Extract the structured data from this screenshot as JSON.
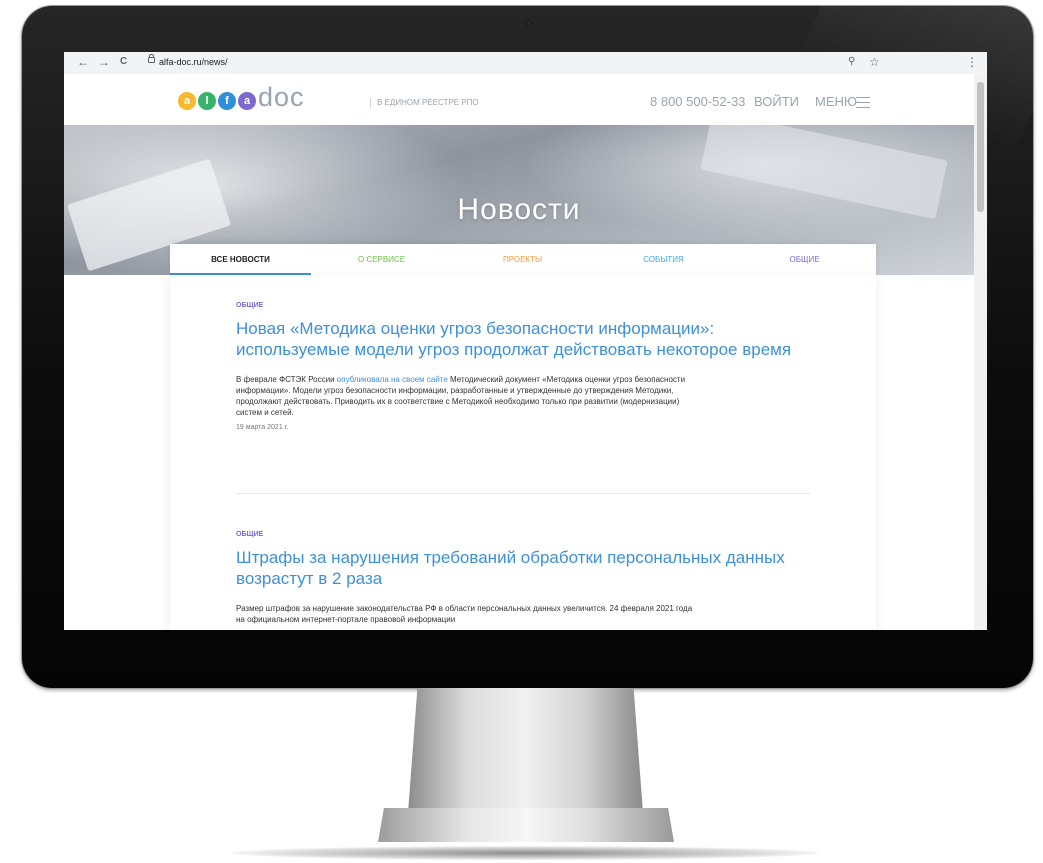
{
  "browser": {
    "back_icon": "arrow-left-icon",
    "forward_icon": "arrow-right-icon",
    "reload_icon": "reload-icon",
    "url": "alfa-doc.ru/news/",
    "back_glyph": "←",
    "forward_glyph": "→",
    "reload_glyph": "C",
    "zoom_glyph": "⚲",
    "star_glyph": "☆",
    "menu_glyph": "⋮"
  },
  "header": {
    "logo": {
      "letters": [
        "a",
        "l",
        "f",
        "a"
      ],
      "colors": [
        "#f5b82e",
        "#39b36b",
        "#2f8fd8",
        "#7c6ad1"
      ],
      "suffix": "doc"
    },
    "registry": "В ЕДИНОМ РЕЕСТРЕ РПО",
    "phone": "8 800 500-52-33",
    "login": "ВОЙТИ",
    "menu": "МЕНЮ"
  },
  "banner": {
    "title": "Новости"
  },
  "tabs": [
    {
      "label": "ВСЕ НОВОСТИ",
      "color": "#222222",
      "active": true
    },
    {
      "label": "О СЕРВИСЕ",
      "color": "#6cc04a",
      "active": false
    },
    {
      "label": "ПРОЕКТЫ",
      "color": "#f39a3d",
      "active": false
    },
    {
      "label": "СОБЫТИЯ",
      "color": "#3ea9e4",
      "active": false
    },
    {
      "label": "ОБЩИЕ",
      "color": "#7c6ad1",
      "active": false
    }
  ],
  "articles": [
    {
      "category": "ОБЩИЕ",
      "title": "Новая «Методика оценки угроз безопасности информации»: используемые модели угроз продолжат действовать некоторое время",
      "text_before": "В феврале ФСТЭК России ",
      "link": "опубликовала на своем сайте",
      "text_after": " Методический документ «Методика оценки угроз безопасности информации». Модели угроз безопасности информации, разработанные и утвержденные до утверждения Методики, продолжают действовать. Приводить их в соответствие с Методикой необходимо только при развитии (модернизации) систем и сетей.",
      "date": "19 марта 2021 г."
    },
    {
      "category": "ОБЩИЕ",
      "title": "Штрафы за нарушения требований обработки персональных данных возрастут в 2 раза",
      "text": "Размер штрафов за нарушение законодательства РФ в области персональных данных увеличится. 24 февраля 2021 года на официальном интернет-портале правовой информации"
    }
  ]
}
